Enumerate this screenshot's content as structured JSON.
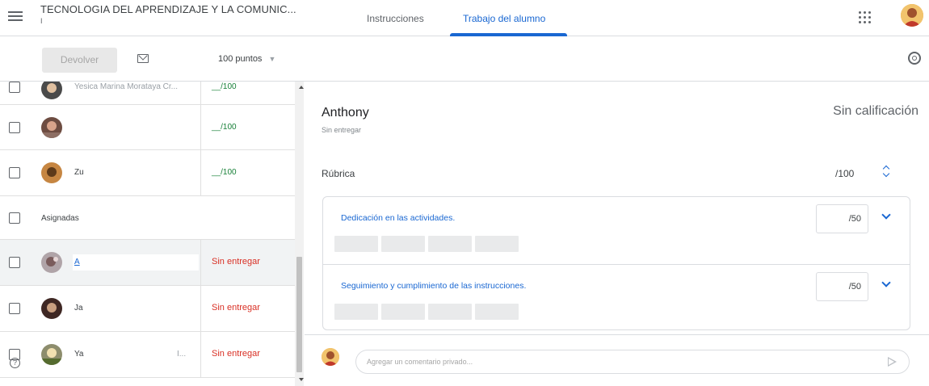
{
  "header": {
    "course_title": "TECNOLOGIA DEL APRENDIZAJE Y LA COMUNIC...",
    "course_subtitle": "I",
    "tabs": [
      {
        "label": "Instrucciones",
        "active": false
      },
      {
        "label": "Trabajo del alumno",
        "active": true
      }
    ],
    "apps_icon": "apps-grid-icon",
    "account_icon": "user-avatar"
  },
  "toolbar": {
    "return_label": "Devolver",
    "mail_icon": "mail-icon",
    "points_value": "100 puntos",
    "settings_icon": "gear-icon"
  },
  "students": [
    {
      "name": "Yesica Marina Morataya Cr...",
      "grade": "__/100",
      "status": ""
    },
    {
      "name": "",
      "grade": "__/100",
      "status": ""
    },
    {
      "name": "Zu",
      "grade": "__/100",
      "status": ""
    },
    {
      "section_label": "Asignadas"
    },
    {
      "name": "A",
      "grade": "",
      "status": "Sin entregar",
      "selected": true
    },
    {
      "name": "Ja",
      "grade": "",
      "status": "Sin entregar"
    },
    {
      "name": "Ya",
      "grade": "",
      "status": "Sin entregar",
      "extra": "I..."
    }
  ],
  "detail": {
    "student_name": "Anthony",
    "submission_status": "Sin entregar",
    "grade_status": "Sin calificación",
    "rubric": {
      "label": "Rúbrica",
      "total": "/100",
      "criteria": [
        {
          "title": "Dedicación en las actividades.",
          "score": "/50",
          "level_count": 4
        },
        {
          "title": "Seguimiento y cumplimiento de las instrucciones.",
          "score": "/50",
          "level_count": 4
        }
      ]
    },
    "comment": {
      "placeholder": "Agregar un comentario privado...",
      "send_icon": "send-icon"
    }
  },
  "colors": {
    "accent": "#1967d2",
    "grade_green": "#188038",
    "status_red": "#d93025",
    "avatar_orange": "#e8a33a"
  }
}
